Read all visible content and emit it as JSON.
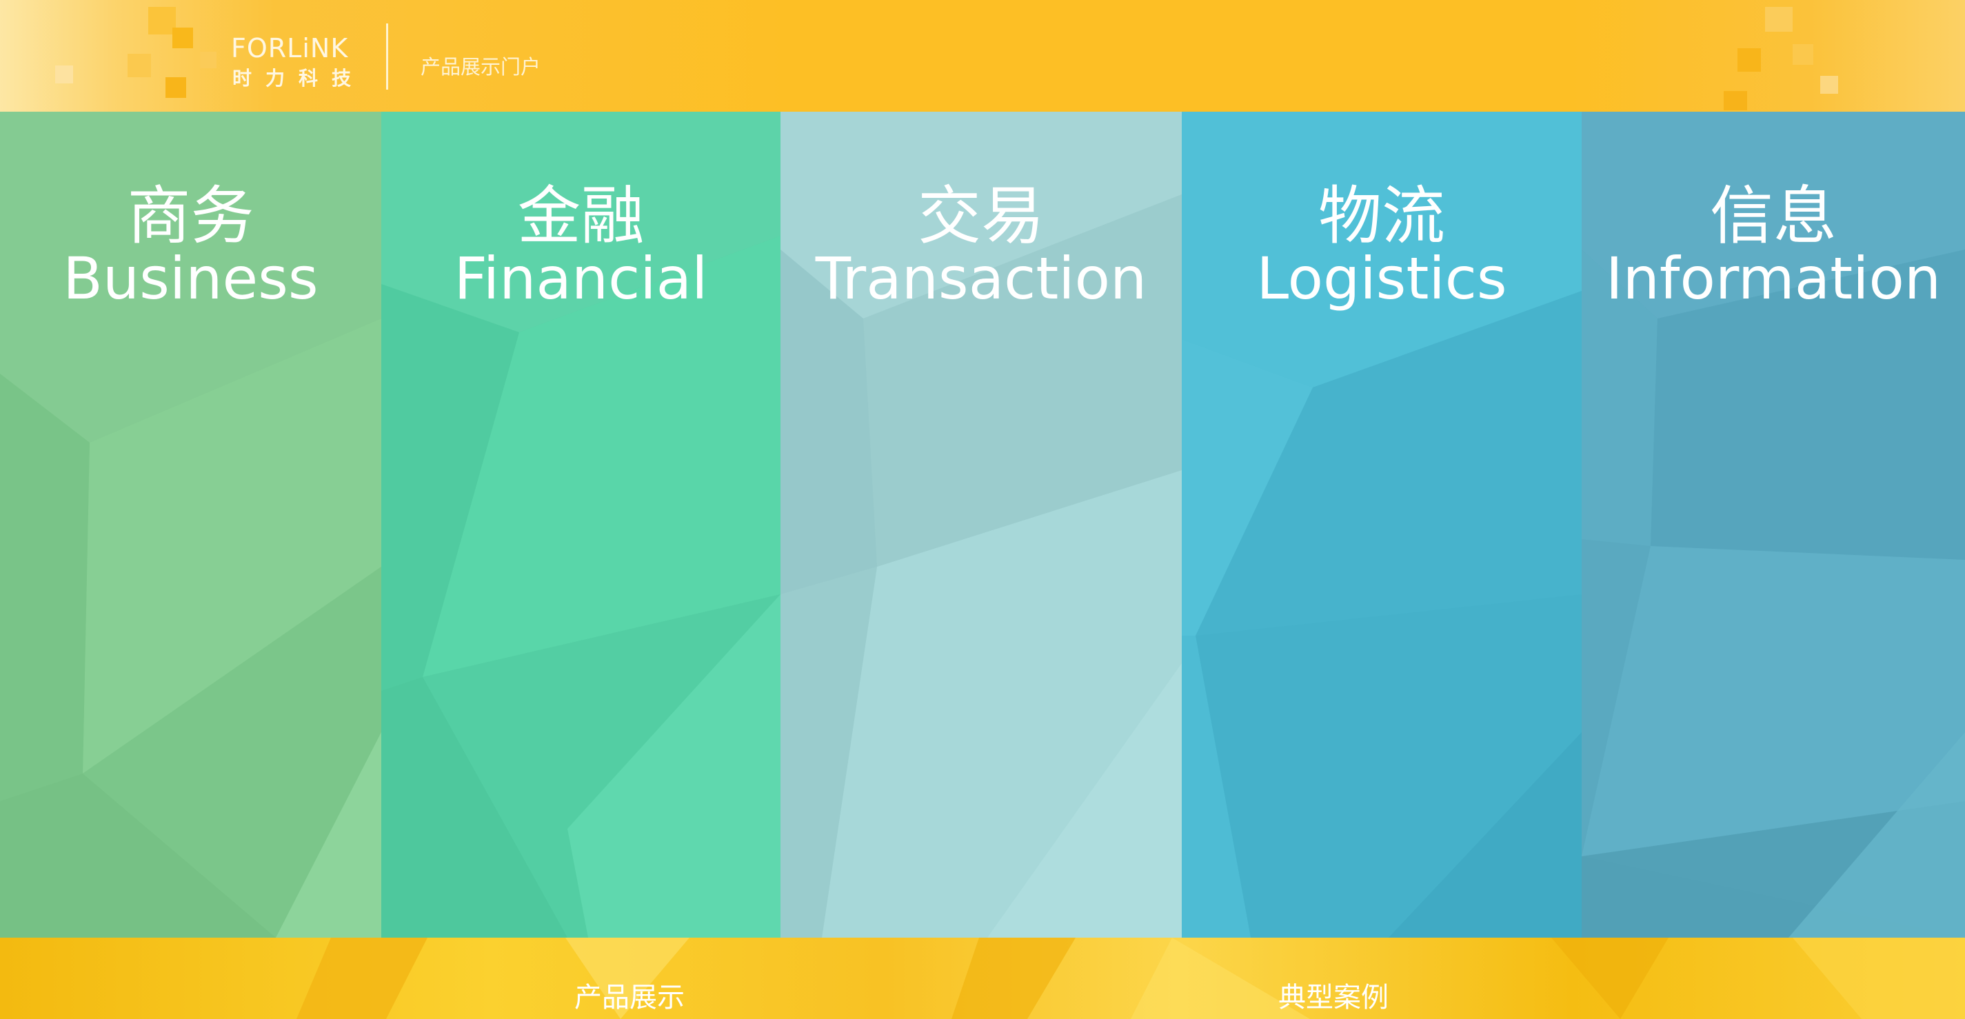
{
  "header": {
    "logo_en": "FORLiNK",
    "logo_cn": "时力科技",
    "portal_title": "产品展示门户"
  },
  "colors": {
    "header": "#fdbf25",
    "footer": "#f8c224",
    "business": "#7fc88c",
    "financial": "#56cfa4",
    "transaction": "#9ecfd0",
    "logistics": "#4bb8d0",
    "information": "#5aa9c0"
  },
  "panels": [
    {
      "key": "business",
      "cn": "商务",
      "en": "Business",
      "color": "#7fc88c"
    },
    {
      "key": "financial",
      "cn": "金融",
      "en": "Financial",
      "color": "#56cfa4"
    },
    {
      "key": "transaction",
      "cn": "交易",
      "en": "Transaction",
      "color": "#9ecfd0"
    },
    {
      "key": "logistics",
      "cn": "物流",
      "en": "Logistics",
      "color": "#4bb8d0"
    },
    {
      "key": "information",
      "cn": "信息",
      "en": "Information",
      "color": "#5aa9c0"
    }
  ],
  "footer": {
    "links": [
      "产品展示",
      "典型案例"
    ]
  }
}
